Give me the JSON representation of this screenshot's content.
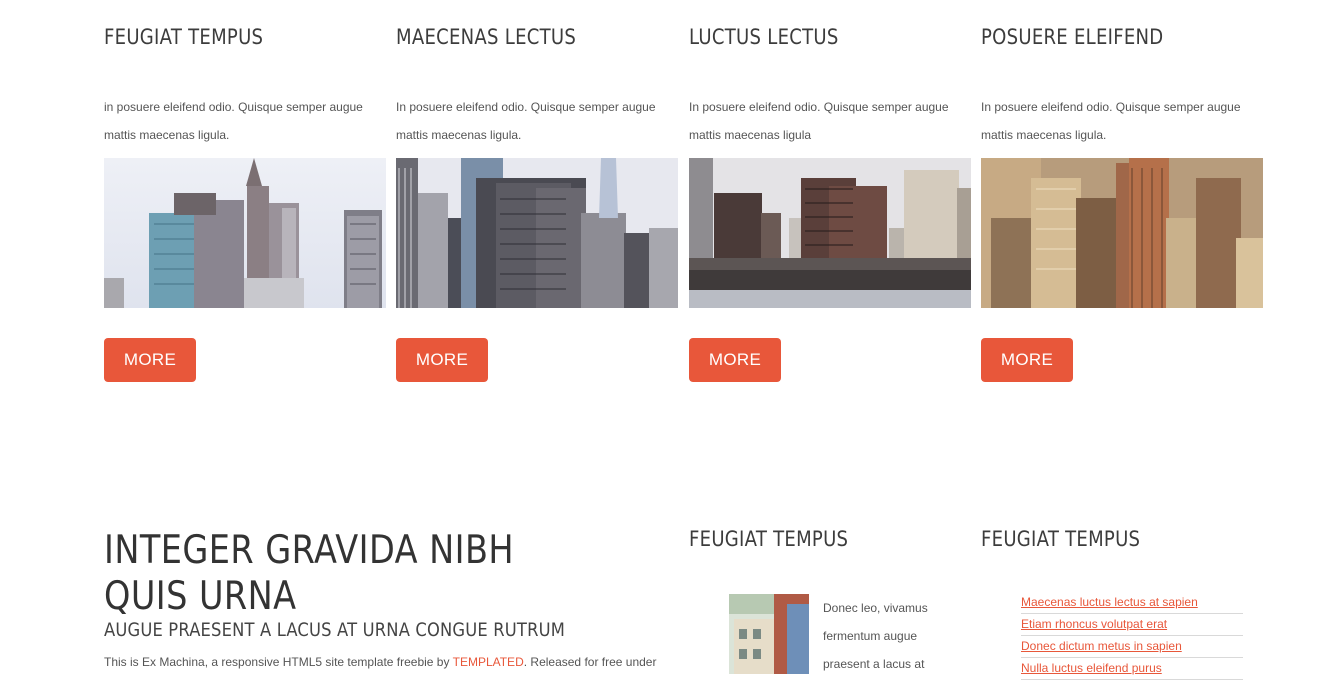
{
  "features": [
    {
      "title": "FEUGIAT TEMPUS",
      "text": "in posuere eleifend odio. Quisque semper augue mattis maecenas ligula.",
      "button": "MORE"
    },
    {
      "title": "MAECENAS LECTUS",
      "text": "In posuere eleifend odio. Quisque semper augue mattis maecenas ligula.",
      "button": "MORE"
    },
    {
      "title": "LUCTUS LECTUS",
      "text": "In posuere eleifend odio. Quisque semper augue mattis maecenas ligula",
      "button": "MORE"
    },
    {
      "title": "POSUERE ELEIFEND",
      "text": "In posuere eleifend odio. Quisque semper augue mattis maecenas ligula.",
      "button": "MORE"
    }
  ],
  "main": {
    "title": "INTEGER GRAVIDA NIBH QUIS URNA",
    "subtitle": "AUGUE PRAESENT A LACUS AT URNA CONGUE RUTRUM",
    "body_before": "This is Ex Machina, a responsive HTML5 site template freebie by ",
    "body_link": "TEMPLATED",
    "body_after": ". Released for free under"
  },
  "side_middle": {
    "title": "FEUGIAT TEMPUS",
    "text": "Donec leo, vivamus fermentum augue praesent a lacus at"
  },
  "side_right": {
    "title": "FEUGIAT TEMPUS",
    "links": [
      "Maecenas luctus lectus at sapien",
      "Etiam rhoncus volutpat erat",
      "Donec dictum metus in sapien",
      "Nulla luctus eleifend purus"
    ]
  },
  "colors": {
    "accent": "#e8573a",
    "heading": "#3c3c3c",
    "text": "#555555"
  }
}
